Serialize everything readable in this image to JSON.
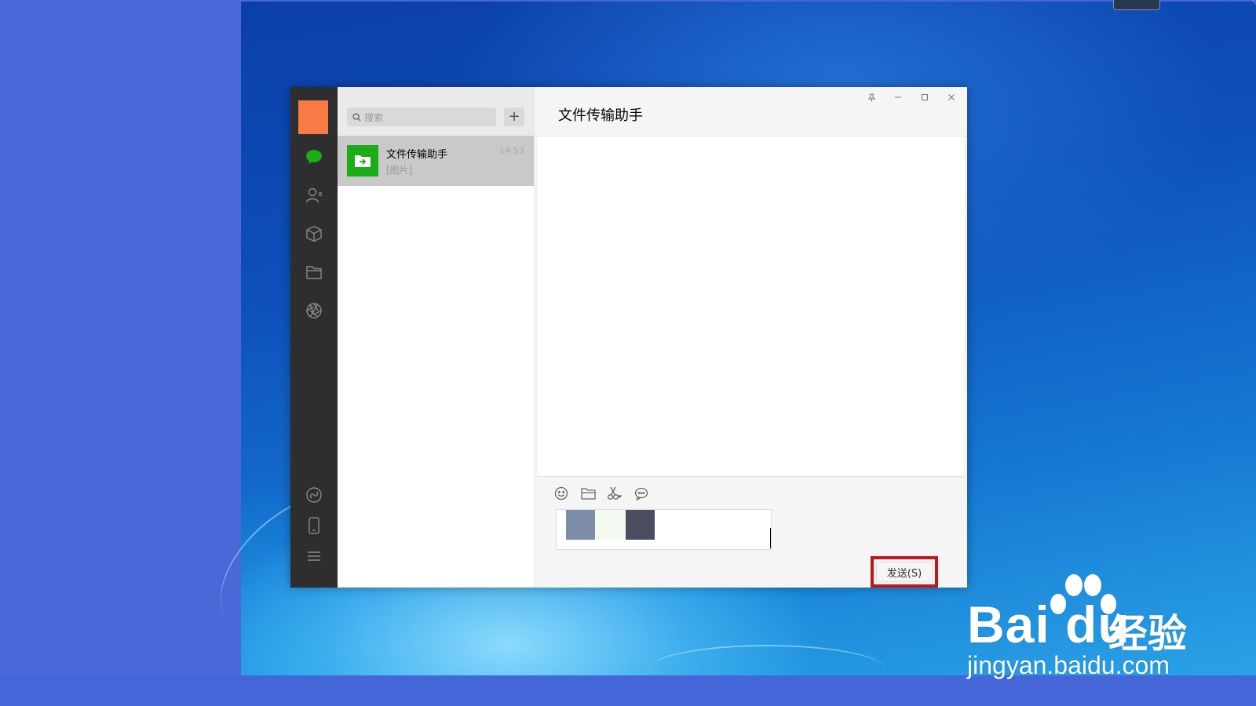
{
  "app": {
    "title": "文件传输助手"
  },
  "search": {
    "placeholder": "搜索",
    "add_label": "+"
  },
  "chats": [
    {
      "name": "文件传输助手",
      "preview": "[图片]",
      "time": "14:53"
    }
  ],
  "composer": {
    "send_label": "发送(S)"
  },
  "watermark": {
    "brand": "Bai du",
    "subtitle": "经验",
    "url": "jingyan.baidu.com"
  },
  "colors": {
    "accent": "#1aad19",
    "avatar": "#f87a45",
    "highlight": "#c6141b"
  },
  "icons": {
    "sidebar": [
      "chat-icon",
      "contacts-icon",
      "favorites-icon",
      "files-icon",
      "moments-icon"
    ],
    "sidebar_bottom": [
      "mini-program-icon",
      "phone-icon",
      "menu-icon"
    ],
    "toolbar": [
      "emoji-icon",
      "folder-icon",
      "screenshot-icon",
      "chat-history-icon"
    ],
    "window": [
      "pin-icon",
      "minimize-icon",
      "maximize-icon",
      "close-icon"
    ]
  }
}
